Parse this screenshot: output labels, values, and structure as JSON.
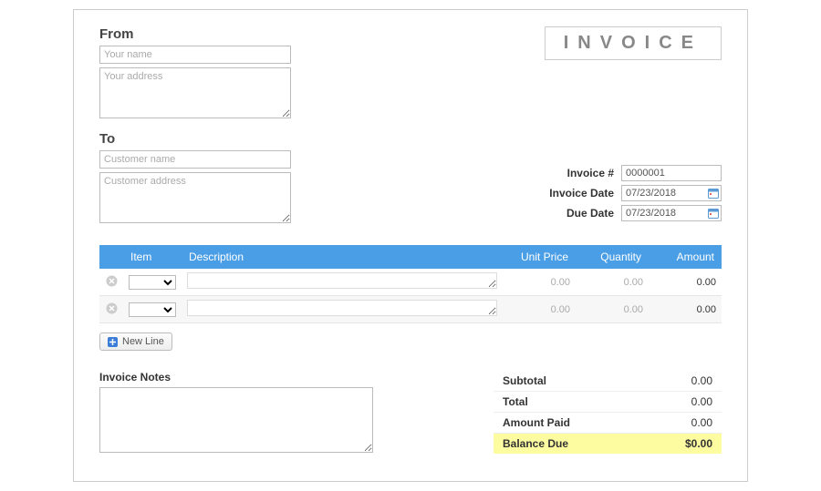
{
  "title": "INVOICE",
  "from": {
    "heading": "From",
    "name_placeholder": "Your name",
    "name_value": "",
    "address_placeholder": "Your address",
    "address_value": ""
  },
  "to": {
    "heading": "To",
    "name_placeholder": "Customer name",
    "name_value": "",
    "address_placeholder": "Customer address",
    "address_value": ""
  },
  "meta": {
    "number_label": "Invoice #",
    "number_value": "0000001",
    "date_label": "Invoice Date",
    "date_value": "07/23/2018",
    "due_label": "Due Date",
    "due_value": "07/23/2018"
  },
  "columns": {
    "item": "Item",
    "description": "Description",
    "unit_price": "Unit Price",
    "quantity": "Quantity",
    "amount": "Amount"
  },
  "rows": [
    {
      "item": "",
      "description": "",
      "unit_price": "0.00",
      "quantity": "0.00",
      "amount": "0.00"
    },
    {
      "item": "",
      "description": "",
      "unit_price": "0.00",
      "quantity": "0.00",
      "amount": "0.00"
    }
  ],
  "new_line_label": "New Line",
  "notes": {
    "label": "Invoice Notes",
    "value": ""
  },
  "totals": {
    "subtotal_label": "Subtotal",
    "subtotal_value": "0.00",
    "total_label": "Total",
    "total_value": "0.00",
    "paid_label": "Amount Paid",
    "paid_value": "0.00",
    "balance_label": "Balance Due",
    "balance_value": "$0.00"
  }
}
